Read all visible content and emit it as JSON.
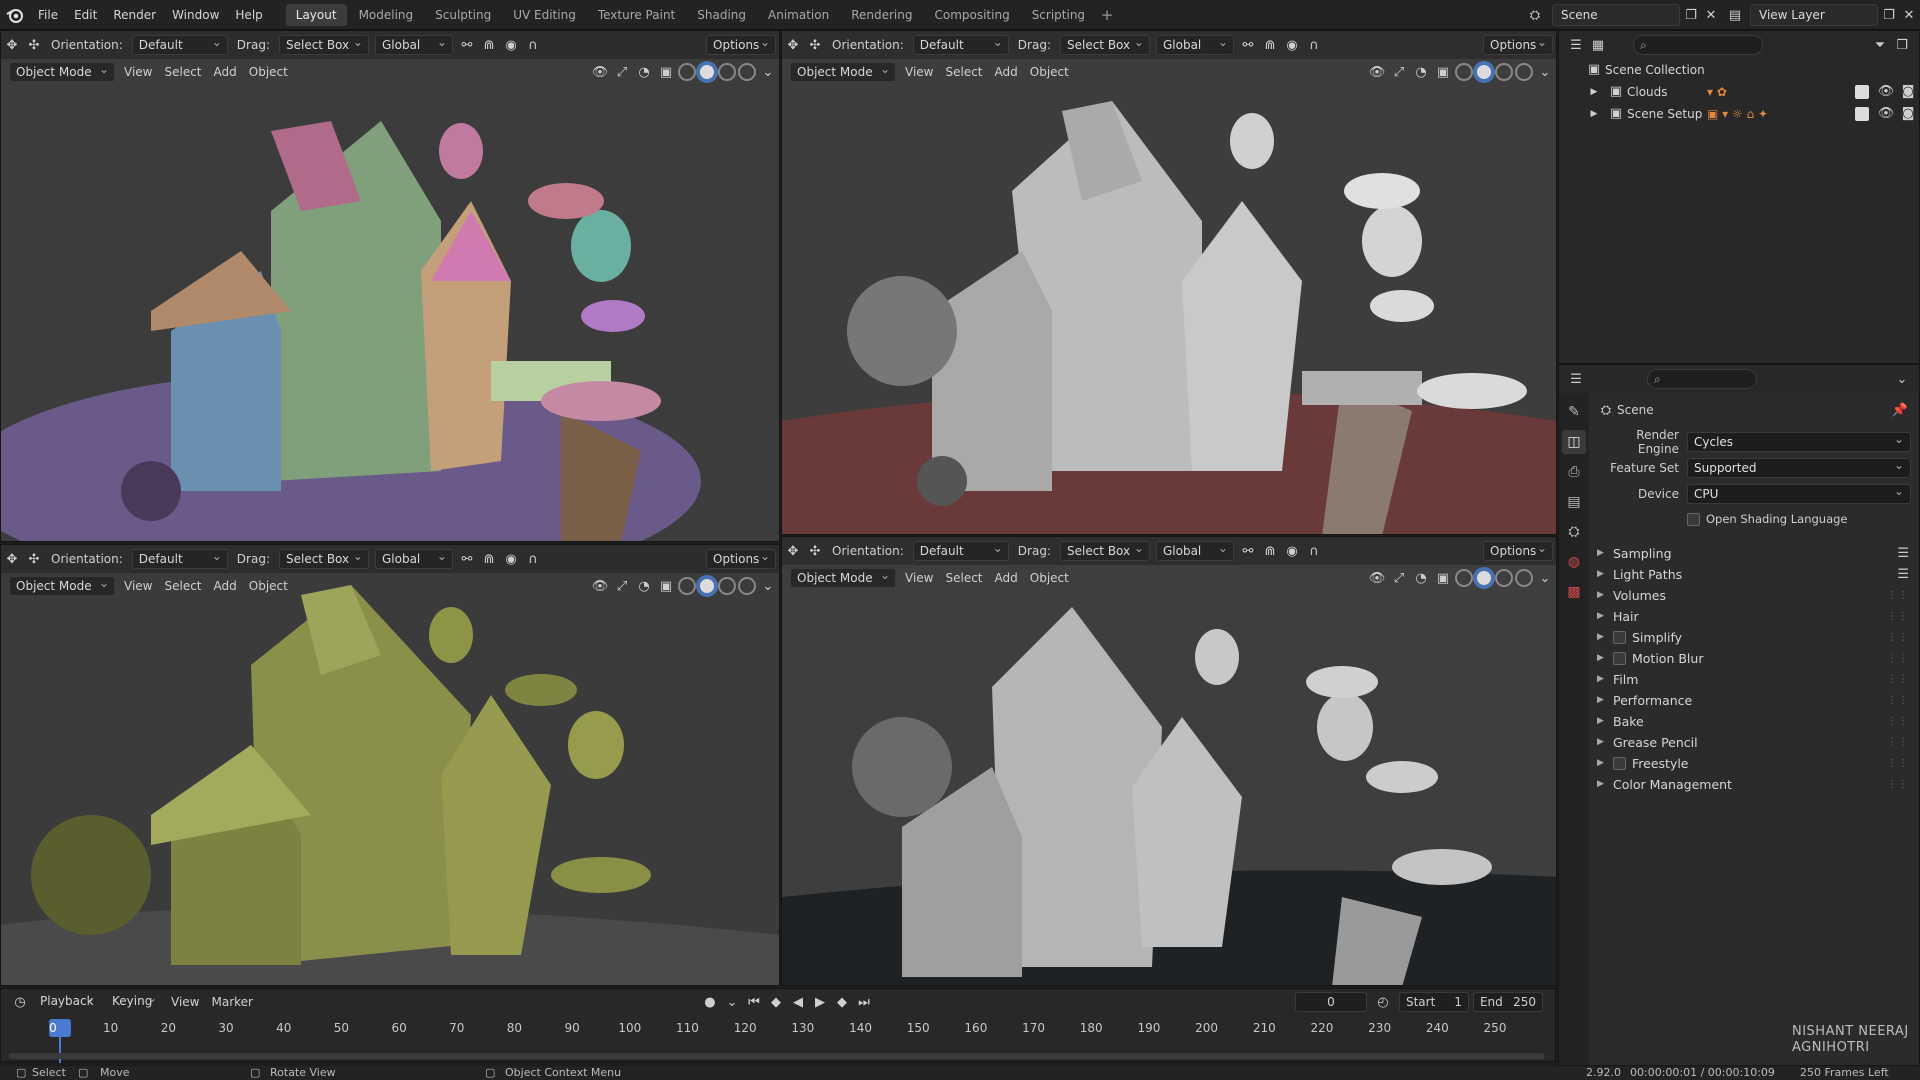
{
  "menu": [
    "File",
    "Edit",
    "Render",
    "Window",
    "Help"
  ],
  "workspaces": [
    "Layout",
    "Modeling",
    "Sculpting",
    "UV Editing",
    "Texture Paint",
    "Shading",
    "Animation",
    "Rendering",
    "Compositing",
    "Scripting"
  ],
  "active_workspace": "Layout",
  "scene_name": "Scene",
  "view_layer": "View Layer",
  "viewport_header": {
    "orientation_label": "Orientation:",
    "orientation_value": "Default",
    "drag_label": "Drag:",
    "drag_value": "Select Box",
    "transform_value": "Global",
    "options_label": "Options",
    "mode_value": "Object Mode",
    "view_menu": "View",
    "select_menu": "Select",
    "add_menu": "Add",
    "object_menu": "Object"
  },
  "viewports": [
    {
      "name": "top-left",
      "shading": "random-color",
      "bg": "#3c3c3c"
    },
    {
      "name": "top-right",
      "shading": "clay",
      "bg": "#3d3d3d"
    },
    {
      "name": "bottom-left",
      "shading": "single-color",
      "bg": "#3b3b3b"
    },
    {
      "name": "bottom-right",
      "shading": "cavity",
      "bg": "#3e3e3e"
    }
  ],
  "outliner": {
    "root": "Scene Collection",
    "items": [
      "Clouds",
      "Scene Setup"
    ]
  },
  "properties": {
    "title": "Scene",
    "render_engine_label": "Render Engine",
    "render_engine": "Cycles",
    "feature_set_label": "Feature Set",
    "feature_set": "Supported",
    "device_label": "Device",
    "device": "CPU",
    "osl_label": "Open Shading Language",
    "panels": [
      {
        "label": "Sampling",
        "checkbox": false,
        "list": true
      },
      {
        "label": "Light Paths",
        "checkbox": false,
        "list": true
      },
      {
        "label": "Volumes",
        "checkbox": false,
        "list": false
      },
      {
        "label": "Hair",
        "checkbox": false,
        "list": false
      },
      {
        "label": "Simplify",
        "checkbox": true,
        "list": false
      },
      {
        "label": "Motion Blur",
        "checkbox": true,
        "list": false
      },
      {
        "label": "Film",
        "checkbox": false,
        "list": false
      },
      {
        "label": "Performance",
        "checkbox": false,
        "list": false
      },
      {
        "label": "Bake",
        "checkbox": false,
        "list": false
      },
      {
        "label": "Grease Pencil",
        "checkbox": false,
        "list": false
      },
      {
        "label": "Freestyle",
        "checkbox": true,
        "list": false
      },
      {
        "label": "Color Management",
        "checkbox": false,
        "list": false
      }
    ]
  },
  "timeline": {
    "menus": [
      "Playback",
      "Keying",
      "View",
      "Marker"
    ],
    "current_frame": "0",
    "start_label": "Start",
    "start": "1",
    "end_label": "End",
    "end": "250",
    "ticks": [
      "0",
      "10",
      "20",
      "30",
      "40",
      "50",
      "60",
      "70",
      "80",
      "90",
      "100",
      "110",
      "120",
      "130",
      "140",
      "150",
      "160",
      "170",
      "180",
      "190",
      "200",
      "210",
      "220",
      "230",
      "240",
      "250"
    ]
  },
  "status": {
    "select": "Select",
    "move": "Move",
    "rotate": "Rotate View",
    "context": "Object Context Menu",
    "version": "2.92.0",
    "time": "00:00:00:01 / 00:00:10:09",
    "frames_left": "250 Frames Left"
  },
  "watermark": [
    "NISHANT NEERAJ",
    "AGNIHOTRI"
  ],
  "colors": {
    "accent": "#4772b3",
    "playhead": "#4a7bd1"
  }
}
